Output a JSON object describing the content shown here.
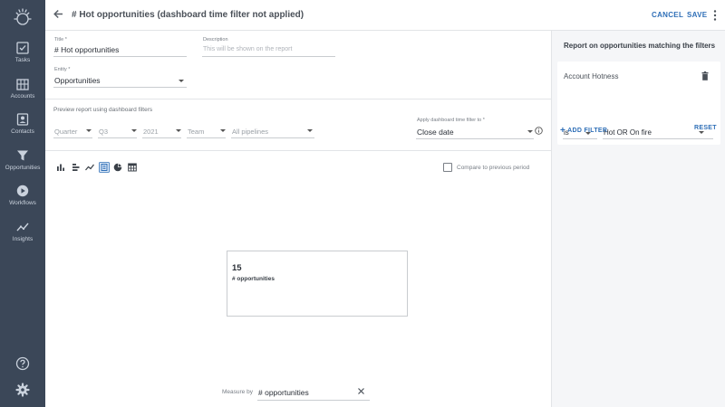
{
  "sidebar": {
    "items": [
      {
        "label": "Tasks",
        "icon": "tasks-icon"
      },
      {
        "label": "Accounts",
        "icon": "accounts-icon"
      },
      {
        "label": "Contacts",
        "icon": "contacts-icon"
      },
      {
        "label": "Opportunities",
        "icon": "opportunities-icon"
      },
      {
        "label": "Workflows",
        "icon": "workflows-icon"
      },
      {
        "label": "Insights",
        "icon": "insights-icon"
      }
    ],
    "bottom_icons": [
      "help-icon",
      "settings-icon"
    ]
  },
  "header": {
    "title": "# Hot opportunities (dashboard time filter not applied)",
    "cancel_label": "CANCEL",
    "save_label": "SAVE"
  },
  "form": {
    "title_label": "Title *",
    "title_value": "# Hot opportunities",
    "description_label": "Description",
    "description_placeholder": "This will be shown on the report",
    "entity_label": "Entity *",
    "entity_value": "Opportunities"
  },
  "preview": {
    "section_label": "Preview report using dashboard filters",
    "filters": {
      "period": "Quarter",
      "quarter": "Q3",
      "year": "2021",
      "team": "Team",
      "pipeline": "All pipelines"
    },
    "apply_label": "Apply dashboard time filter to *",
    "apply_value": "Close date"
  },
  "chart_toolbar": {
    "icons": [
      "bar-chart-icon",
      "horizontal-bar-icon",
      "line-chart-icon",
      "number-icon",
      "pie-chart-icon",
      "table-icon"
    ],
    "compare_label": "Compare to previous period"
  },
  "metric": {
    "value": "15",
    "label": "# opportunities"
  },
  "measure": {
    "label": "Measure by",
    "value": "# opportunities"
  },
  "right_panel": {
    "title": "Report on opportunities matching the filters",
    "filter": {
      "name": "Account Hotness",
      "operator": "is",
      "value": "Hot  OR  On fire"
    },
    "add_filter_label": "ADD FILTER",
    "reset_label": "RESET"
  },
  "colors": {
    "sidebar_bg": "#3b4758",
    "accent": "#2f6fb7",
    "panel_bg": "#f5f6f8"
  }
}
